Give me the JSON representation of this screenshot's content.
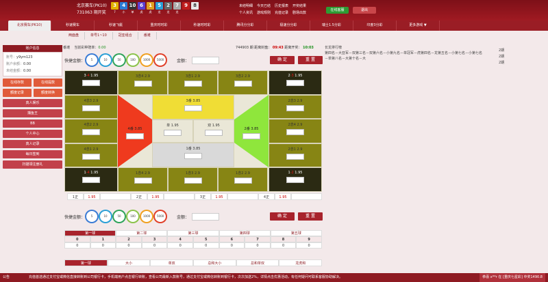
{
  "header": {
    "lottery_name": "北京赛车(PK10)",
    "issue_label": "731063 期开奖",
    "balls": [
      {
        "n": "3",
        "z": "7",
        "c": "#e2b200"
      },
      {
        "n": "4",
        "z": "小",
        "c": "#2a7bd5"
      },
      {
        "n": "10",
        "z": "单",
        "c": "#333"
      },
      {
        "n": "6",
        "z": "虎",
        "c": "#5a3fd0"
      },
      {
        "n": "1",
        "z": "虎",
        "c": "#e0a020"
      },
      {
        "n": "5",
        "z": "龙",
        "c": "#2aa0d8"
      },
      {
        "n": "2",
        "z": "龙",
        "c": "#666"
      },
      {
        "n": "7",
        "z": "龙",
        "c": "#aaa"
      },
      {
        "n": "9",
        "z": "",
        "c": "#c01c1c"
      },
      {
        "n": "8",
        "z": "",
        "c": "#e8e8e8"
      }
    ],
    "links1": [
      "未结明细",
      "今天已结",
      "历史报表",
      "开奖结果"
    ],
    "links2": [
      "个人资讯",
      "游戏规则",
      "充值记录",
      "剧场出款"
    ],
    "online_label": "在线客服",
    "logout_label": "退出"
  },
  "tabs": [
    "北京赛车(PK10)",
    "秒速赛车",
    "秒速飞艇",
    "重庆时时彩",
    "秒速时时彩",
    "腾讯分分彩",
    "极速分分彩",
    "瑞士1.5分彩",
    "印度3分彩",
    "更多游戏 ▼"
  ],
  "subnav": [
    "两面盘",
    "单号1~10",
    "冠亚组合",
    "番滩"
  ],
  "sidebar": {
    "title": "账户信息",
    "account_label": "账号：",
    "account": "y9ym123",
    "balance_label": "账户余额：",
    "balance": "0.00",
    "unsettled_label": "未结金额：",
    "unsettled": "0.00",
    "grid_buttons": [
      "在线存款",
      "在线提款",
      "额度记录",
      "额度转换"
    ],
    "buttons": [
      "真人娱乐",
      "捕鱼王",
      "BB",
      "个人中心",
      "真人记录",
      "每日签到",
      "扫描领注册礼"
    ]
  },
  "info": {
    "left": "番滩",
    "odds_label": "当前彩种赔率：",
    "odds": "0.00"
  },
  "draw": {
    "issue": "744903",
    "issue_text": "期 距离封盘：",
    "close_time": "09:43",
    "open_text": "距离开奖：",
    "open_time": "10:03"
  },
  "rank": {
    "title": "长龙排行榜",
    "text": "第四名－大亚军－双第三名－双第六名－小第九名－单冠军－虎第四名－龙第五名－小第七名－小第七名－单第八名－大第十名－大",
    "right": [
      "2期",
      "2期",
      "2期"
    ]
  },
  "quick": {
    "label": "快捷金额：",
    "chips": [
      "5",
      "10",
      "50",
      "100",
      "1000",
      "5000"
    ],
    "amount_label": "金额：",
    "confirm": "确 定",
    "reset": "重 置"
  },
  "board": {
    "corners": [
      {
        "l": "3-4",
        "o": "1.95"
      },
      {
        "l": "2-3",
        "o": "1.95"
      },
      {
        "l": "1-4",
        "o": "1.95"
      },
      {
        "l": "1-2",
        "o": "1.95"
      }
    ],
    "top": [
      {
        "l": "3念4",
        "o": "2.9"
      },
      {
        "l": "3念1",
        "o": "2.9"
      },
      {
        "l": "3念2",
        "o": "2.9"
      }
    ],
    "bottom": [
      {
        "l": "1念4",
        "o": "2.9"
      },
      {
        "l": "1念3",
        "o": "2.9"
      },
      {
        "l": "1念2",
        "o": "2.9"
      }
    ],
    "left": [
      {
        "l": "4念3",
        "o": "2.9"
      },
      {
        "l": "4念2",
        "o": "2.9"
      },
      {
        "l": "4念1",
        "o": "2.9"
      }
    ],
    "right": [
      {
        "l": "2念3",
        "o": "2.9"
      },
      {
        "l": "2念4",
        "o": "2.9"
      },
      {
        "l": "2念1",
        "o": "2.9"
      }
    ],
    "fan3": {
      "l": "3番",
      "o": "3.85"
    },
    "fan1": {
      "l": "1番",
      "o": "3.85"
    },
    "fan4": {
      "l": "4番",
      "o": "3.85"
    },
    "fan2": {
      "l": "2番",
      "o": "3.85"
    },
    "odd": {
      "l": "单",
      "o": "1.95"
    },
    "even": {
      "l": "双",
      "o": "1.95"
    }
  },
  "positions": [
    {
      "l": "1正",
      "o": "1.95"
    },
    {
      "l": "2正",
      "o": "1.95"
    },
    {
      "l": "3正",
      "o": "1.95"
    },
    {
      "l": "4正",
      "o": "1.95"
    }
  ],
  "results": {
    "tabs": [
      "第一球",
      "第二球",
      "第三球",
      "第四球",
      "第五球"
    ],
    "heads": [
      "0",
      "1",
      "2",
      "3",
      "4",
      "5",
      "6",
      "7",
      "8",
      "9"
    ],
    "vals": [
      "0",
      "0",
      "0",
      "0",
      "0",
      "0",
      "0",
      "0",
      "0",
      "0"
    ]
  },
  "bottom_tabs": [
    "第一球",
    "大小",
    "单双",
    "总和大小",
    "总和单双",
    "龙虎和"
  ],
  "footer": {
    "left": "公告",
    "text": "充值首选通过支付宝或微信直接转账到公司银行卡，手机端用户点击银行转账，查看公司最新入款账号，通过支付宝或微信转账到银行卡，次次加送2%，详情点击优惠活动，有任何疑问可联系客服协助解决。",
    "right": "恭喜 x**r 在 [重庆七星彩] 中奖1490.8"
  }
}
